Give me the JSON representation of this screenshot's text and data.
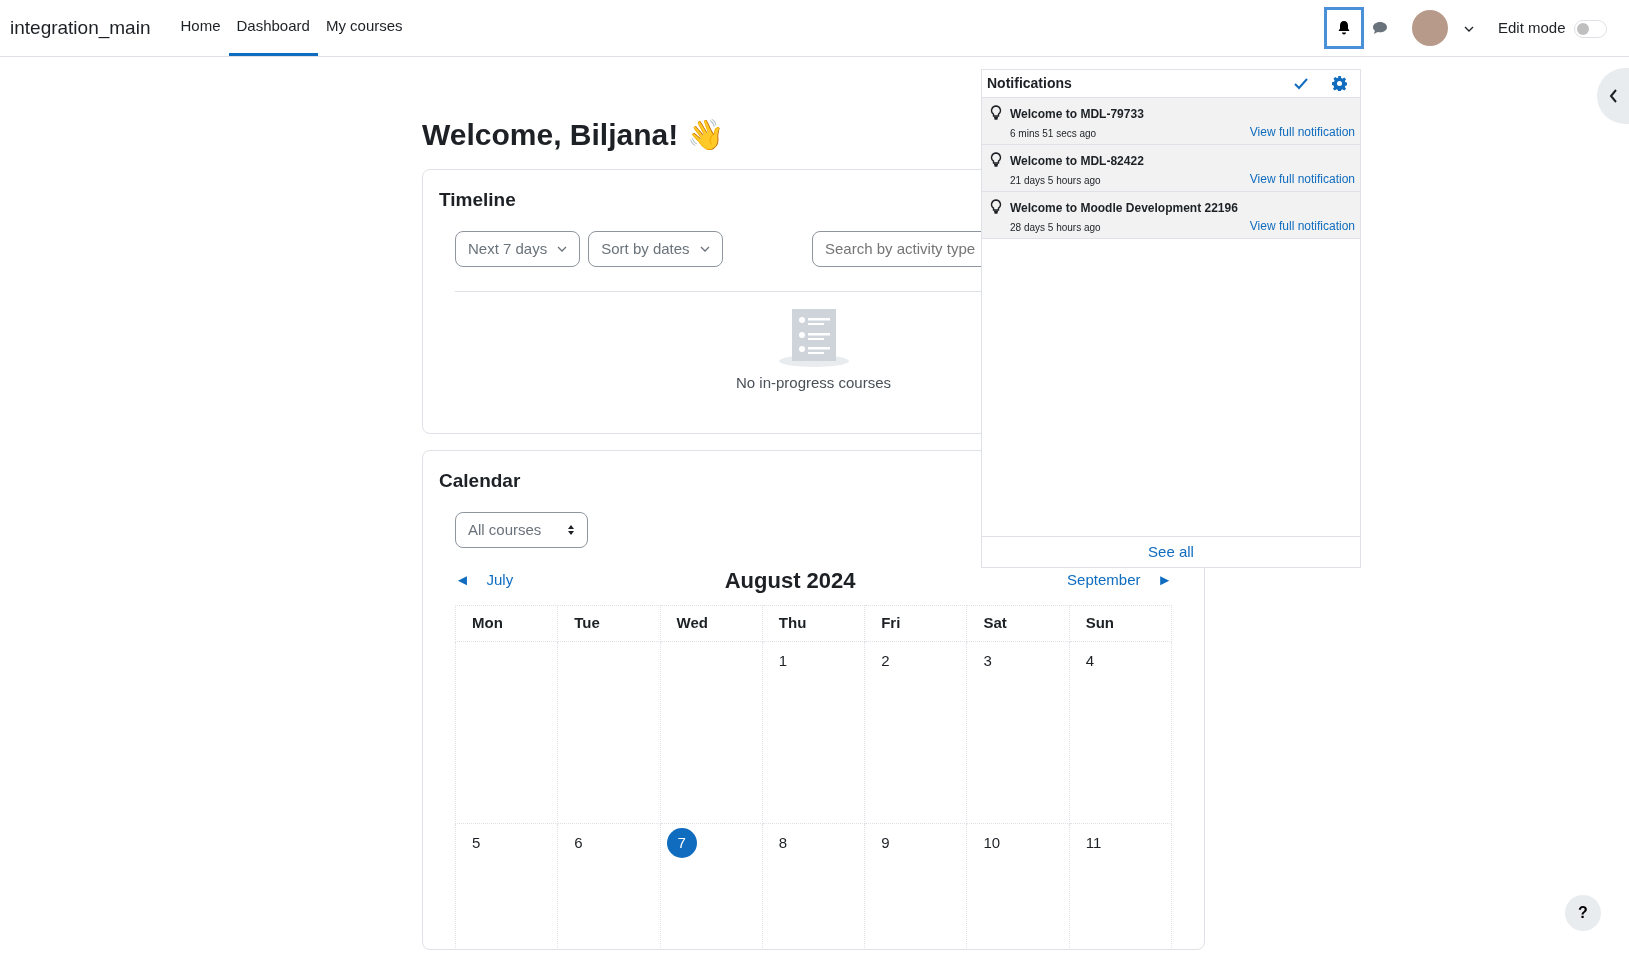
{
  "site_name": "integration_main",
  "nav": [
    {
      "label": "Home",
      "selected": false
    },
    {
      "label": "Dashboard",
      "selected": true
    },
    {
      "label": "My courses",
      "selected": false
    }
  ],
  "edit_mode": {
    "label": "Edit mode",
    "on": false
  },
  "welcome": "Welcome, Biljana! 👋",
  "timeline": {
    "title": "Timeline",
    "filters": [
      "Next 7 days",
      "Sort by dates"
    ],
    "search": {
      "placeholder": "Search by activity type"
    },
    "empty_text": "No in-progress courses"
  },
  "calendar": {
    "title": "Calendar",
    "course_filter": "All courses",
    "prev": {
      "arrow": "◄",
      "label": "July"
    },
    "month": "August 2024",
    "next": {
      "label": "September",
      "arrow": "►"
    },
    "weekdays": [
      "Mon",
      "Tue",
      "Wed",
      "Thu",
      "Fri",
      "Sat",
      "Sun"
    ],
    "weeks": [
      [
        {
          "day": "1",
          "today": false
        },
        {
          "day": "2",
          "today": false
        },
        {
          "day": "3",
          "today": false
        },
        {
          "day": "4",
          "today": false
        }
      ],
      [
        {
          "day": "5",
          "today": false
        },
        {
          "day": "6",
          "today": false
        },
        {
          "day": "7",
          "today": true
        },
        {
          "day": "8",
          "today": false
        },
        {
          "day": "9",
          "today": false
        },
        {
          "day": "10",
          "today": false
        },
        {
          "day": "11",
          "today": false
        }
      ]
    ]
  },
  "notifications": {
    "title": "Notifications",
    "items": [
      {
        "title": "Welcome to MDL-79733",
        "time": "6 mins 51 secs ago",
        "link": "View full notification"
      },
      {
        "title": "Welcome to MDL-82422",
        "time": "21 days 5 hours ago",
        "link": "View full notification"
      },
      {
        "title": "Welcome to Moodle Development 22196",
        "time": "28 days 5 hours ago",
        "link": "View full notification"
      }
    ],
    "see_all": "See all"
  },
  "help": "?"
}
